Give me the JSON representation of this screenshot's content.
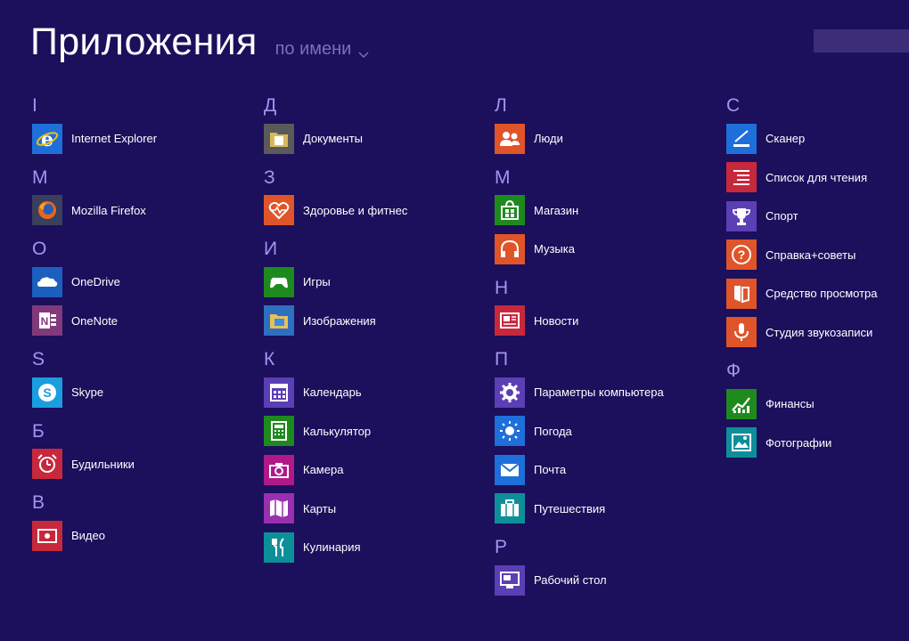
{
  "header": {
    "title": "Приложения",
    "sort_label": "по имени"
  },
  "columns": [
    [
      {
        "letter": "I",
        "apps": [
          {
            "label": "Internet Explorer",
            "icon": "internet-explorer-icon",
            "color": "#1e6fd9"
          }
        ]
      },
      {
        "letter": "M",
        "apps": [
          {
            "label": "Mozilla Firefox",
            "icon": "firefox-icon",
            "color": "#3a3f5c"
          }
        ]
      },
      {
        "letter": "O",
        "apps": [
          {
            "label": "OneDrive",
            "icon": "onedrive-icon",
            "color": "#1b5fbf"
          },
          {
            "label": "OneNote",
            "icon": "onenote-icon",
            "color": "#80397b"
          }
        ]
      },
      {
        "letter": "S",
        "apps": [
          {
            "label": "Skype",
            "icon": "skype-icon",
            "color": "#1a9ee0"
          }
        ]
      },
      {
        "letter": "Б",
        "apps": [
          {
            "label": "Будильники",
            "icon": "alarm-clock-icon",
            "color": "#c8283c"
          }
        ]
      },
      {
        "letter": "В",
        "apps": [
          {
            "label": "Видео",
            "icon": "video-icon",
            "color": "#c8283c"
          }
        ]
      }
    ],
    [
      {
        "letter": "Д",
        "apps": [
          {
            "label": "Документы",
            "icon": "documents-folder-icon",
            "color": "#5a5a5a"
          }
        ]
      },
      {
        "letter": "З",
        "apps": [
          {
            "label": "Здоровье и фитнес",
            "icon": "heart-pulse-icon",
            "color": "#e0542a"
          }
        ]
      },
      {
        "letter": "И",
        "apps": [
          {
            "label": "Игры",
            "icon": "gamepad-icon",
            "color": "#1e8a1e"
          },
          {
            "label": "Изображения",
            "icon": "pictures-folder-icon",
            "color": "#2f6fc0"
          }
        ]
      },
      {
        "letter": "К",
        "apps": [
          {
            "label": "Календарь",
            "icon": "calendar-icon",
            "color": "#5b3fb5"
          },
          {
            "label": "Калькулятор",
            "icon": "calculator-icon",
            "color": "#1e8a1e"
          },
          {
            "label": "Камера",
            "icon": "camera-icon",
            "color": "#b0198a"
          },
          {
            "label": "Карты",
            "icon": "maps-icon",
            "color": "#9a2fb0"
          },
          {
            "label": "Кулинария",
            "icon": "cutlery-icon",
            "color": "#0d8f9a"
          }
        ]
      }
    ],
    [
      {
        "letter": "Л",
        "apps": [
          {
            "label": "Люди",
            "icon": "people-icon",
            "color": "#e0542a"
          }
        ]
      },
      {
        "letter": "М",
        "apps": [
          {
            "label": "Магазин",
            "icon": "store-icon",
            "color": "#1e8a1e"
          },
          {
            "label": "Музыка",
            "icon": "headphones-icon",
            "color": "#e0542a"
          }
        ]
      },
      {
        "letter": "Н",
        "apps": [
          {
            "label": "Новости",
            "icon": "news-icon",
            "color": "#c8283c"
          }
        ]
      },
      {
        "letter": "П",
        "apps": [
          {
            "label": "Параметры компьютера",
            "icon": "gear-icon",
            "color": "#5b3fb5"
          },
          {
            "label": "Погода",
            "icon": "sun-icon",
            "color": "#1e6fd9"
          },
          {
            "label": "Почта",
            "icon": "mail-icon",
            "color": "#1e6fd9"
          },
          {
            "label": "Путешествия",
            "icon": "suitcase-icon",
            "color": "#0d8f9a"
          }
        ]
      },
      {
        "letter": "Р",
        "apps": [
          {
            "label": "Рабочий стол",
            "icon": "desktop-icon",
            "color": "#5b3fb5"
          }
        ]
      }
    ],
    [
      {
        "letter": "С",
        "apps": [
          {
            "label": "Сканер",
            "icon": "scanner-icon",
            "color": "#1e6fd9"
          },
          {
            "label": "Список для чтения",
            "icon": "reading-list-icon",
            "color": "#c8283c"
          },
          {
            "label": "Спорт",
            "icon": "trophy-icon",
            "color": "#5b3fb5"
          },
          {
            "label": "Справка+советы",
            "icon": "help-icon",
            "color": "#e0542a"
          },
          {
            "label": "Средство просмотра",
            "icon": "reader-icon",
            "color": "#e0542a"
          },
          {
            "label": "Студия звукозаписи",
            "icon": "microphone-icon",
            "color": "#e0542a"
          }
        ]
      },
      {
        "letter": "Ф",
        "apps": [
          {
            "label": "Финансы",
            "icon": "finance-chart-icon",
            "color": "#1e8a1e"
          },
          {
            "label": "Фотографии",
            "icon": "photos-icon",
            "color": "#0d8f9a"
          }
        ]
      }
    ]
  ]
}
